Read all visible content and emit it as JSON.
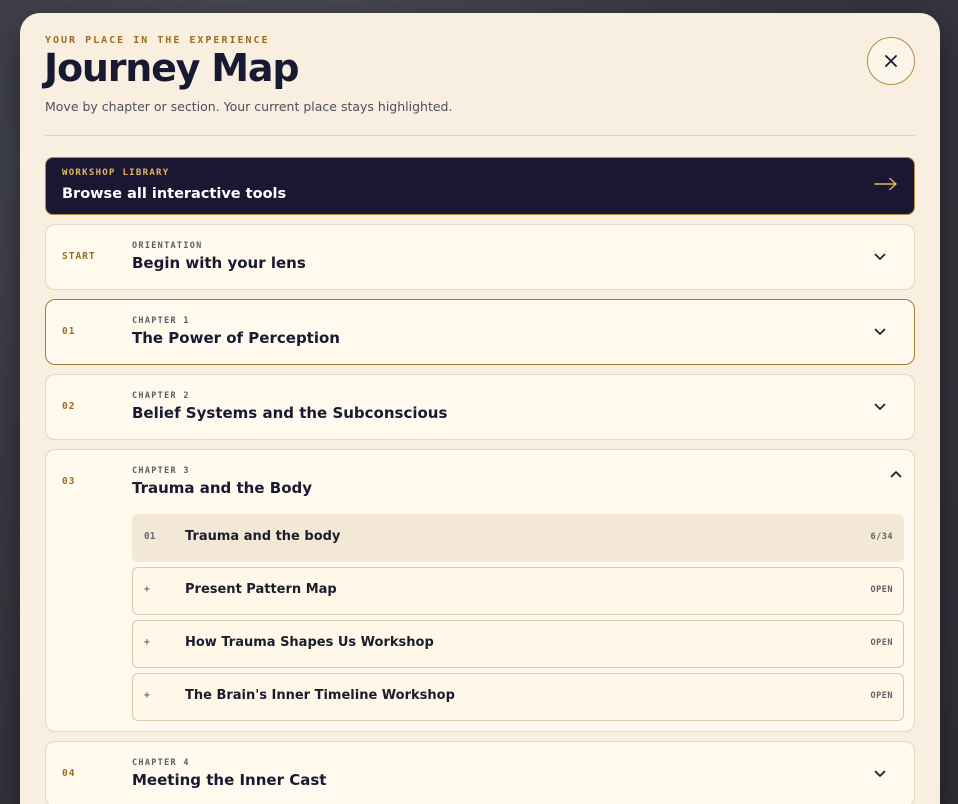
{
  "header": {
    "eyebrow": "YOUR PLACE IN THE EXPERIENCE",
    "title": "Journey Map",
    "subtitle": "Move by chapter or section. Your current place stays highlighted.",
    "close_icon": "close-icon"
  },
  "library": {
    "eyebrow": "WORKSHOP LIBRARY",
    "title": "Browse all interactive tools",
    "arrow_icon": "arrow-right-icon"
  },
  "chapters": [
    {
      "num": "START",
      "eyebrow": "ORIENTATION",
      "title": "Begin with your lens",
      "expanded": false,
      "active": false
    },
    {
      "num": "01",
      "eyebrow": "CHAPTER 1",
      "title": "The Power of Perception",
      "expanded": false,
      "active": true
    },
    {
      "num": "02",
      "eyebrow": "CHAPTER 2",
      "title": "Belief Systems and the Subconscious",
      "expanded": false,
      "active": false
    },
    {
      "num": "03",
      "eyebrow": "CHAPTER 3",
      "title": "Trauma and the Body",
      "expanded": true,
      "active": false,
      "sections": [
        {
          "num": "01",
          "title": "Trauma and the body",
          "meta": "6/34",
          "current": true
        },
        {
          "num": "+",
          "title": "Present Pattern Map",
          "meta": "OPEN",
          "current": false
        },
        {
          "num": "+",
          "title": "How Trauma Shapes Us Workshop",
          "meta": "OPEN",
          "current": false
        },
        {
          "num": "+",
          "title": "The Brain's Inner Timeline Workshop",
          "meta": "OPEN",
          "current": false
        }
      ]
    },
    {
      "num": "04",
      "eyebrow": "CHAPTER 4",
      "title": "Meeting the Inner Cast",
      "expanded": false,
      "active": false
    }
  ],
  "colors": {
    "accent": "#9a6d22",
    "navy": "#1a1733",
    "panel": "#f8efe1",
    "card": "#fff9ee"
  }
}
